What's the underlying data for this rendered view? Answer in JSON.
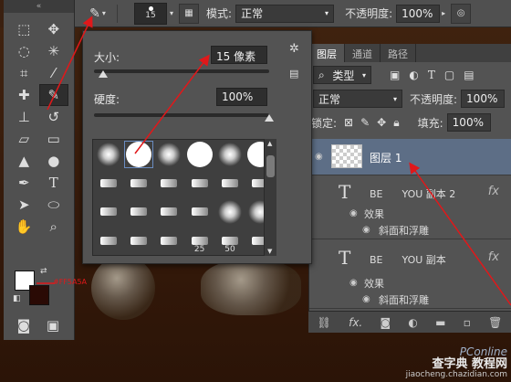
{
  "options_bar": {
    "brush_size": "15",
    "mode_label": "模式:",
    "mode_value": "正常",
    "opacity_label": "不透明度:",
    "opacity_value": "100%"
  },
  "brush_popup": {
    "size_label": "大小:",
    "size_value": "15 像素",
    "size_slider_level": 0.05,
    "hardness_label": "硬度:",
    "hardness_value": "100%",
    "hardness_slider_level": 1.0,
    "preset_numbers": [
      "25",
      "50"
    ]
  },
  "layers_panel": {
    "tabs": [
      "图层",
      "通道",
      "路径"
    ],
    "filter_label": "类型",
    "blend_mode": "正常",
    "opacity_label": "不透明度:",
    "opacity_value": "100%",
    "lock_label": "锁定:",
    "fill_label": "填充:",
    "fill_value": "100%",
    "layers": [
      {
        "name": "图层 1"
      },
      {
        "name": "BE      YOU 副本 2",
        "effects_label": "效果",
        "effect": "斜面和浮雕"
      },
      {
        "name": "BE      YOU 副本",
        "effects_label": "效果",
        "effect": "斜面和浮雕"
      }
    ]
  },
  "colors": {
    "annotation_red": "#e0181a",
    "foreground": "#ffffff",
    "background": "#2a0a05"
  },
  "watermark": {
    "line1": "查字典 教程网",
    "line2": "jiaocheng.chazidian.com",
    "brand": "PConline"
  },
  "annotation": "#FF5A5A"
}
